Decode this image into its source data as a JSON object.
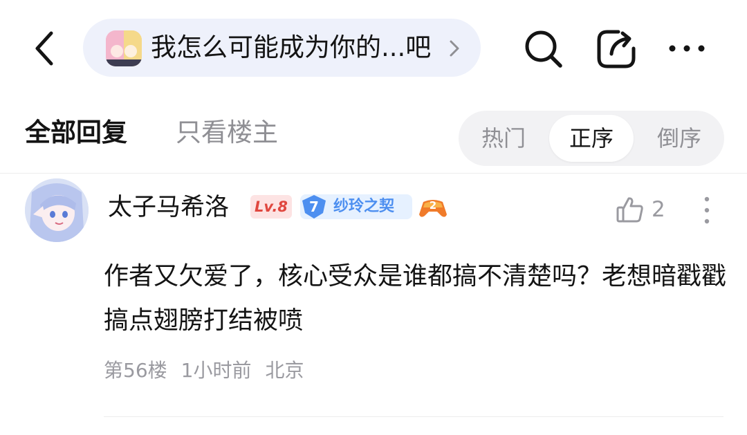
{
  "header": {
    "forum_title": "我怎么可能成为你的...吧"
  },
  "icons": {
    "back": "chevron-left-icon",
    "forum_chevron": "chevron-right-icon",
    "search": "search-icon",
    "share": "share-icon",
    "more": "more-horizontal-icon",
    "like": "thumbs-up-icon",
    "post_more": "more-vertical-icon",
    "game_badge": "game-controller-icon"
  },
  "filter": {
    "tabs": [
      {
        "label": "全部回复",
        "active": true
      },
      {
        "label": "只看楼主",
        "active": false
      }
    ],
    "sort": [
      {
        "label": "热门",
        "active": false
      },
      {
        "label": "正序",
        "active": true
      },
      {
        "label": "倒序",
        "active": false
      }
    ]
  },
  "post": {
    "username": "太子马希洛",
    "level": "Lv.8",
    "fan_badge": {
      "number": "7",
      "name": "纱玲之契"
    },
    "game_badge_number": "2",
    "likes": "2",
    "content": "作者又欠爱了，核心受众是谁都搞不清楚吗？老想暗戳戳搞点翅膀打结被喷",
    "meta": {
      "floor": "第56楼",
      "time": "1小时前",
      "location": "北京"
    }
  },
  "colors": {
    "accent_blue": "#4d8ff0",
    "level_red": "#e0473f",
    "muted_text": "#9a9aa0",
    "pill_bg": "#eef1fb"
  }
}
